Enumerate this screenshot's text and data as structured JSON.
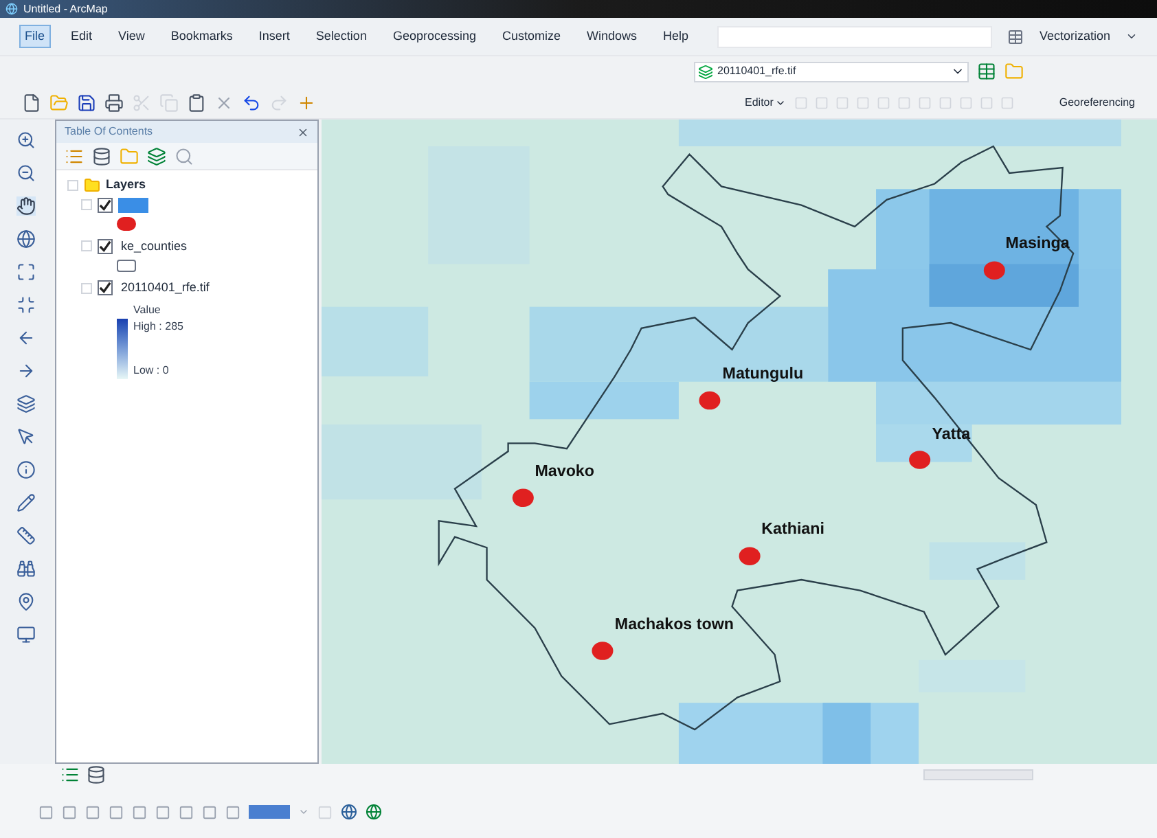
{
  "window": {
    "title": "Untitled - ArcMap"
  },
  "menu": [
    {
      "label": "File",
      "selected": true
    },
    {
      "label": "Edit",
      "selected": false
    },
    {
      "label": "View",
      "selected": false
    },
    {
      "label": "Bookmarks",
      "selected": false
    },
    {
      "label": "Insert",
      "selected": false
    },
    {
      "label": "Selection",
      "selected": false
    },
    {
      "label": "Geoprocessing",
      "selected": false
    },
    {
      "label": "Customize",
      "selected": false
    },
    {
      "label": "Windows",
      "selected": false
    },
    {
      "label": "Help",
      "selected": false
    }
  ],
  "toolbars": {
    "vectorization": "Vectorization",
    "layer_combo": "20110401_rfe.tif",
    "editor": "Editor",
    "georeferencing": "Georeferencing"
  },
  "toc": {
    "title": "Table Of Contents",
    "root": "Layers",
    "layers": [
      {
        "kind": "point",
        "checked": true,
        "selected": true
      },
      {
        "kind": "polygon",
        "name": "ke_counties",
        "checked": true,
        "selected": false
      },
      {
        "kind": "raster",
        "name": "20110401_rfe.tif",
        "checked": true,
        "selected": false,
        "legend": {
          "heading": "Value",
          "high": "High : 285",
          "low": "Low : 0"
        }
      }
    ]
  },
  "map": {
    "places": [
      {
        "name": "Masinga"
      },
      {
        "name": "Matungulu"
      },
      {
        "name": "Yatta"
      },
      {
        "name": "Mavoko"
      },
      {
        "name": "Kathiani"
      },
      {
        "name": "Machakos town"
      }
    ]
  }
}
